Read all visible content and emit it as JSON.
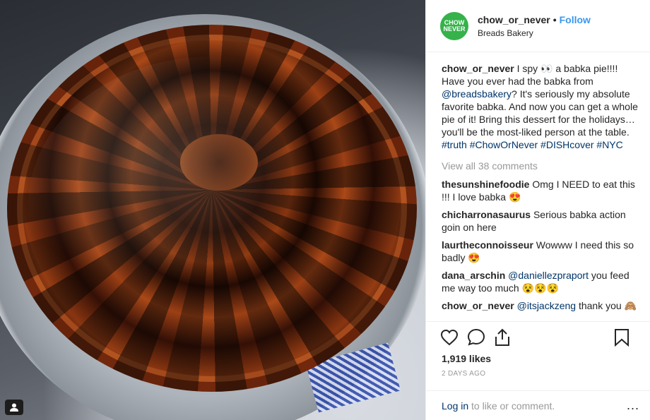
{
  "account": {
    "avatar_text": "CHOW\nNEVER",
    "username": "chow_or_never",
    "separator": "•",
    "follow": "Follow",
    "location": "Breads Bakery",
    "brand_color": "#35b24a"
  },
  "caption": {
    "user": "chow_or_never",
    "text_1": " I spy 👀 a babka pie!!!! Have you ever had the babka from ",
    "mention": "@breadsbakery",
    "text_2": "? It's seriously my absolute favorite babka. And now you can get a whole pie of it! Bring this dessert for the holidays… you'll be the most-liked person at the table. ",
    "tags": "#truth #ChowOrNever #DISHcover #NYC"
  },
  "view_all": "View all 38 comments",
  "comments": [
    {
      "user": "thesunshinefoodie",
      "text": " Omg I NEED to eat this !!! I love babka 😍"
    },
    {
      "user": "chicharronasaurus",
      "text": " Serious babka action goin on here"
    },
    {
      "user": "laurtheconnoisseur",
      "text": " Wowww I need this so badly 😍"
    },
    {
      "user": "dana_arschin",
      "mention": "@daniellezpraport",
      "text": " you feed me way too much 😵😵😵"
    },
    {
      "user": "chow_or_never",
      "mention": "@itsjackzeng",
      "text": " thank you 🙈"
    }
  ],
  "actions": {
    "like_icon": "heart-icon",
    "comment_icon": "comment-icon",
    "share_icon": "share-icon",
    "save_icon": "bookmark-icon"
  },
  "likes": "1,919 likes",
  "timestamp": "2 DAYS AGO",
  "footer": {
    "login": "Log in",
    "rest": " to like or comment.",
    "more": "..."
  }
}
